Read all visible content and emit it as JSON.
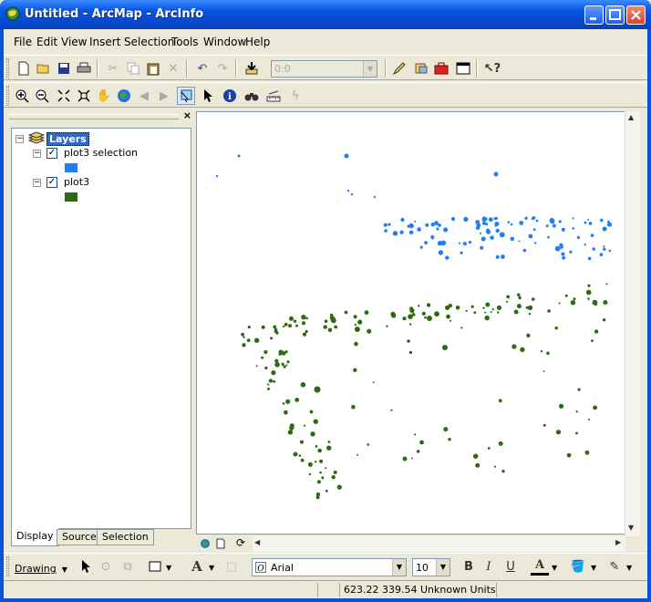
{
  "window": {
    "title": "Untitled - ArcMap - ArcInfo"
  },
  "menus": [
    "File",
    "Edit",
    "View",
    "Insert",
    "Selection",
    "Tools",
    "Window",
    "Help"
  ],
  "standard_toolbar": {
    "scale_value": "0:0"
  },
  "toc": {
    "root_label": "Layers",
    "layers": [
      {
        "name": "plot3 selection",
        "checked": true,
        "symbol_color": "#1f7ef0"
      },
      {
        "name": "plot3",
        "checked": true,
        "symbol_color": "#2d6b12"
      }
    ],
    "tabs": [
      "Display",
      "Source",
      "Selection"
    ],
    "active_tab": "Display"
  },
  "map": {
    "selection_color": "#1f7ef0",
    "plot_color": "#2d6b12"
  },
  "drawing_toolbar": {
    "menu_label": "Drawing",
    "font_name": "Arial",
    "font_size": "10"
  },
  "status": {
    "coordinates": "623.22  339.54 Unknown Units"
  }
}
